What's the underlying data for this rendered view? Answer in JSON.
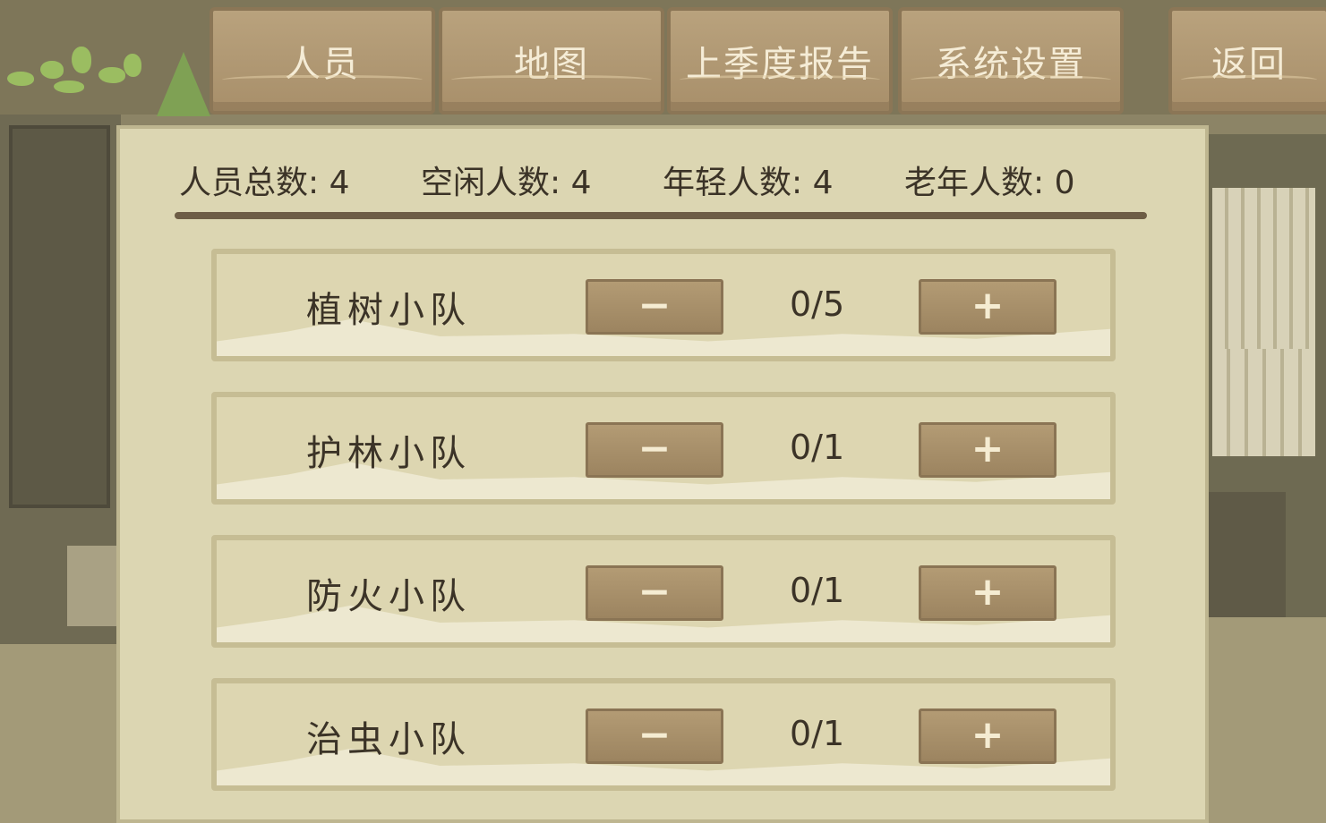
{
  "tabs": [
    {
      "label": "人员"
    },
    {
      "label": "地图"
    },
    {
      "label": "上季度报告"
    },
    {
      "label": "系统设置"
    },
    {
      "label": "返回"
    }
  ],
  "stats": {
    "total": "人员总数: 4",
    "idle": "空闲人数: 4",
    "young": "年轻人数: 4",
    "old": "老年人数: 0"
  },
  "teams": [
    {
      "name": "植树小队",
      "minus": "−",
      "count": "0/5",
      "plus": "+"
    },
    {
      "name": "护林小队",
      "minus": "−",
      "count": "0/1",
      "plus": "+"
    },
    {
      "name": "防火小队",
      "minus": "−",
      "count": "0/1",
      "plus": "+"
    },
    {
      "name": "治虫小队",
      "minus": "−",
      "count": "0/1",
      "plus": "+"
    }
  ],
  "colors": {
    "panel": "#dcd6b2",
    "button": "#a88f6a",
    "text": "#3b3327",
    "tab_text": "#f5ecd6"
  }
}
